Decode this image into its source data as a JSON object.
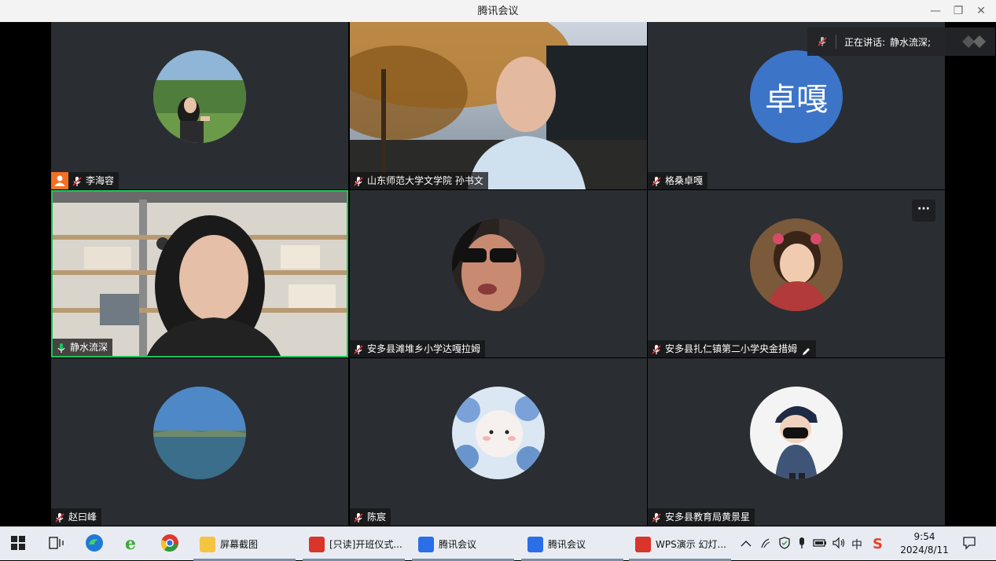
{
  "window": {
    "title": "腾讯会议",
    "controls": {
      "minimize": "—",
      "restore": "❐",
      "close": "✕"
    }
  },
  "speaking_indicator": {
    "label": "正在讲话:",
    "speaker": "静水流深;"
  },
  "participants": [
    {
      "name": "李海容",
      "is_host": true,
      "muted": true,
      "avatar_color": "#5f8a4a",
      "avatar_text": ""
    },
    {
      "name": "山东师范大学文学院 孙书文",
      "is_host": false,
      "muted": true,
      "video": true
    },
    {
      "name": "格桑卓嘎",
      "is_host": false,
      "muted": true,
      "avatar_color": "#3c74c8",
      "avatar_text": "卓嘎"
    },
    {
      "name": "静水流深",
      "is_host": false,
      "muted": false,
      "video": true,
      "active_speaker": true
    },
    {
      "name": "安多县滩堆乡小学达嘎拉姆",
      "is_host": false,
      "muted": true,
      "avatar_color": "#5a3a32",
      "avatar_text": ""
    },
    {
      "name": "安多县扎仁镇第二小学央金措姆",
      "is_host": false,
      "muted": true,
      "avatar_color": "#b23a3a",
      "avatar_text": "",
      "editing": true,
      "more_label": "···"
    },
    {
      "name": "赵曰峰",
      "is_host": false,
      "muted": true,
      "avatar_color": "#4f88c6",
      "avatar_text": ""
    },
    {
      "name": "陈宸",
      "is_host": false,
      "muted": true,
      "avatar_color": "#c6d9ee",
      "avatar_text": ""
    },
    {
      "name": "安多县教育局黄景星",
      "is_host": false,
      "muted": true,
      "avatar_color": "#f2f2f2",
      "avatar_text": ""
    }
  ],
  "taskbar": {
    "apps": [
      {
        "label": "屏幕截图",
        "icon": "folder-icon",
        "color": "#f5c542"
      },
      {
        "label": "[只读]开班仪式...",
        "icon": "wps-writer-icon",
        "color": "#d9352a"
      },
      {
        "label": "腾讯会议",
        "icon": "tencent-meeting-icon",
        "color": "#2a6ee8"
      },
      {
        "label": "腾讯会议",
        "icon": "tencent-meeting-icon",
        "color": "#2a6ee8"
      },
      {
        "label": "WPS演示 幻灯...",
        "icon": "wps-presentation-icon",
        "color": "#d9352a"
      }
    ],
    "ime": "中",
    "time": "9:54",
    "date": "2024/8/11"
  },
  "colors": {
    "tile_bg": "#2a2d31",
    "speaker_border": "#1fc35b",
    "host_badge": "#f37021"
  }
}
